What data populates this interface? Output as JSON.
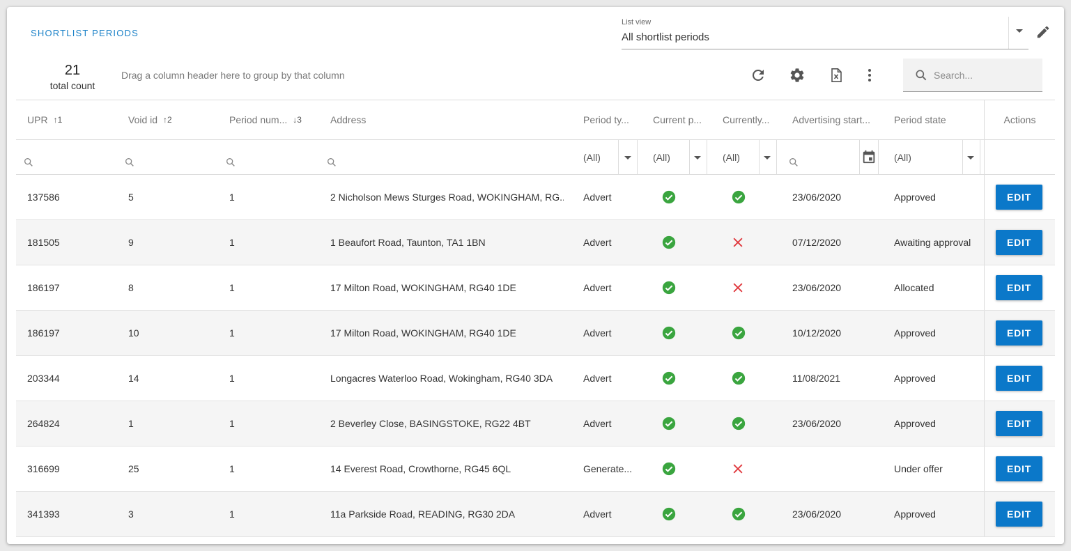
{
  "header": {
    "title": "SHORTLIST PERIODS",
    "list_view_label": "List view",
    "list_view_value": "All shortlist periods"
  },
  "toolbar": {
    "total_count": "21",
    "total_count_label": "total count",
    "group_hint": "Drag a column header here to group by that column",
    "search_placeholder": "Search...",
    "icons": [
      "refresh-icon",
      "settings-icon",
      "excel-export-icon",
      "more-vert-icon"
    ]
  },
  "columns": {
    "upr": "UPR",
    "upr_sort": "↑1",
    "void_id": "Void id",
    "void_sort": "↑2",
    "period_num": "Period num...",
    "period_sort": "↓3",
    "address": "Address",
    "period_type": "Period ty...",
    "current_p": "Current p...",
    "currently": "Currently...",
    "adv_start": "Advertising start...",
    "period_state": "Period state",
    "actions": "Actions"
  },
  "filters": {
    "all": "(All)"
  },
  "colors": {
    "accent": "#1c82c8",
    "button": "#0b78c9",
    "ok": "#3aa53f",
    "no": "#e0393e"
  },
  "rows": [
    {
      "upr": "137586",
      "void": "5",
      "period": "1",
      "address": "2 Nicholson Mews Sturges Road, WOKINGHAM, RG...",
      "type": "Advert",
      "current": true,
      "currently": true,
      "adv": "23/06/2020",
      "state": "Approved",
      "action": "EDIT"
    },
    {
      "upr": "181505",
      "void": "9",
      "period": "1",
      "address": "1 Beaufort Road, Taunton, TA1 1BN",
      "type": "Advert",
      "current": true,
      "currently": false,
      "adv": "07/12/2020",
      "state": "Awaiting approval",
      "action": "EDIT"
    },
    {
      "upr": "186197",
      "void": "8",
      "period": "1",
      "address": "17 Milton Road, WOKINGHAM, RG40 1DE",
      "type": "Advert",
      "current": true,
      "currently": false,
      "adv": "23/06/2020",
      "state": "Allocated",
      "action": "EDIT"
    },
    {
      "upr": "186197",
      "void": "10",
      "period": "1",
      "address": "17 Milton Road, WOKINGHAM, RG40 1DE",
      "type": "Advert",
      "current": true,
      "currently": true,
      "adv": "10/12/2020",
      "state": "Approved",
      "action": "EDIT"
    },
    {
      "upr": "203344",
      "void": "14",
      "period": "1",
      "address": "Longacres Waterloo Road, Wokingham, RG40 3DA",
      "type": "Advert",
      "current": true,
      "currently": true,
      "adv": "11/08/2021",
      "state": "Approved",
      "action": "EDIT"
    },
    {
      "upr": "264824",
      "void": "1",
      "period": "1",
      "address": "2 Beverley Close, BASINGSTOKE, RG22 4BT",
      "type": "Advert",
      "current": true,
      "currently": true,
      "adv": "23/06/2020",
      "state": "Approved",
      "action": "EDIT"
    },
    {
      "upr": "316699",
      "void": "25",
      "period": "1",
      "address": "14 Everest Road, Crowthorne, RG45 6QL",
      "type": "Generate...",
      "current": true,
      "currently": false,
      "adv": "",
      "state": "Under offer",
      "action": "EDIT"
    },
    {
      "upr": "341393",
      "void": "3",
      "period": "1",
      "address": "11a Parkside Road, READING, RG30 2DA",
      "type": "Advert",
      "current": true,
      "currently": true,
      "adv": "23/06/2020",
      "state": "Approved",
      "action": "EDIT"
    }
  ]
}
